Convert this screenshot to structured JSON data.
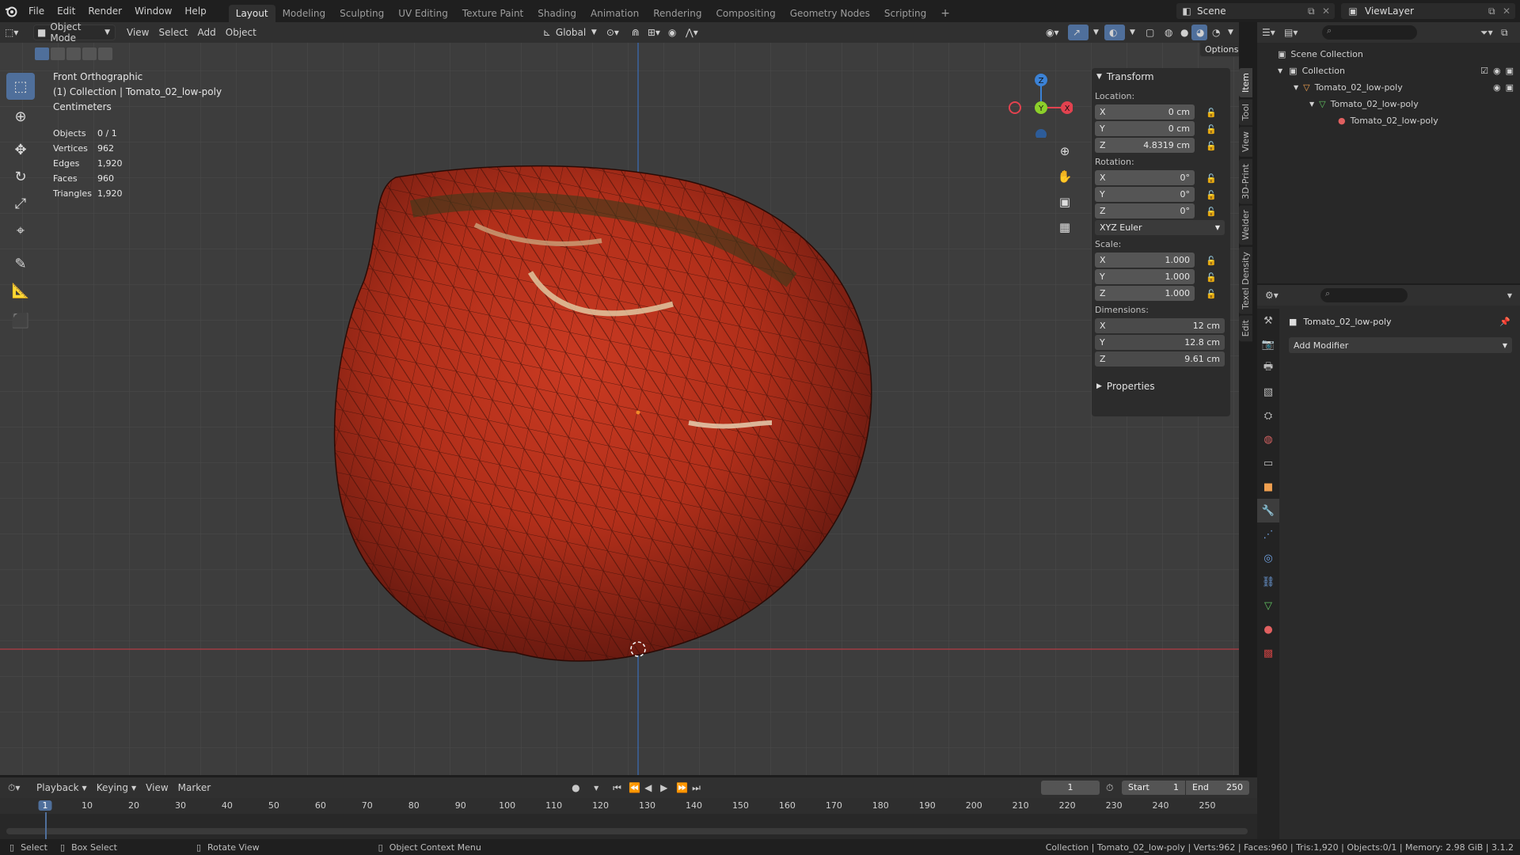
{
  "menu": {
    "items": [
      "File",
      "Edit",
      "Render",
      "Window",
      "Help"
    ],
    "workspaces": [
      "Layout",
      "Modeling",
      "Sculpting",
      "UV Editing",
      "Texture Paint",
      "Shading",
      "Animation",
      "Rendering",
      "Compositing",
      "Geometry Nodes",
      "Scripting"
    ],
    "active_workspace": "Layout",
    "add_tab": "+",
    "scene_label": "Scene",
    "viewlayer_label": "ViewLayer"
  },
  "vp_header": {
    "mode": "Object Mode",
    "menus": [
      "View",
      "Select",
      "Add",
      "Object"
    ],
    "orientation": "Global",
    "options": "Options"
  },
  "overlay": {
    "view_name": "Front Orthographic",
    "collection": "(1) Collection | Tomato_02_low-poly",
    "units": "Centimeters",
    "stats": [
      {
        "label": "Objects",
        "value": "0 / 1"
      },
      {
        "label": "Vertices",
        "value": "962"
      },
      {
        "label": "Edges",
        "value": "1,920"
      },
      {
        "label": "Faces",
        "value": "960"
      },
      {
        "label": "Triangles",
        "value": "1,920"
      }
    ]
  },
  "gizmo": {
    "z": "Z",
    "y": "Y",
    "x": "X"
  },
  "npanel": {
    "title": "Transform",
    "location_label": "Location:",
    "location": [
      {
        "axis": "X",
        "value": "0 cm"
      },
      {
        "axis": "Y",
        "value": "0 cm"
      },
      {
        "axis": "Z",
        "value": "4.8319 cm"
      }
    ],
    "rotation_label": "Rotation:",
    "rotation": [
      {
        "axis": "X",
        "value": "0°"
      },
      {
        "axis": "Y",
        "value": "0°"
      },
      {
        "axis": "Z",
        "value": "0°"
      }
    ],
    "rotation_mode": "XYZ Euler",
    "scale_label": "Scale:",
    "scale": [
      {
        "axis": "X",
        "value": "1.000"
      },
      {
        "axis": "Y",
        "value": "1.000"
      },
      {
        "axis": "Z",
        "value": "1.000"
      }
    ],
    "dimensions_label": "Dimensions:",
    "dimensions": [
      {
        "axis": "X",
        "value": "12 cm"
      },
      {
        "axis": "Y",
        "value": "12.8 cm"
      },
      {
        "axis": "Z",
        "value": "9.61 cm"
      }
    ],
    "properties_label": "Properties",
    "tabs": [
      "Item",
      "Tool",
      "View",
      "3D-Print",
      "Welder",
      "Texel Density",
      "Edit"
    ]
  },
  "outliner": {
    "scene_collection": "Scene Collection",
    "collection": "Collection",
    "object": "Tomato_02_low-poly",
    "mesh": "Tomato_02_low-poly",
    "material": "Tomato_02_low-poly"
  },
  "properties": {
    "object_name": "Tomato_02_low-poly",
    "add_modifier": "Add Modifier"
  },
  "timeline": {
    "menus": [
      "Playback",
      "Keying",
      "View",
      "Marker"
    ],
    "current_frame": "1",
    "start_label": "Start",
    "start": "1",
    "end_label": "End",
    "end": "250",
    "ticks": [
      "1",
      "10",
      "20",
      "30",
      "40",
      "50",
      "60",
      "70",
      "80",
      "90",
      "100",
      "110",
      "120",
      "130",
      "140",
      "150",
      "160",
      "170",
      "180",
      "190",
      "200",
      "210",
      "220",
      "230",
      "240",
      "250"
    ]
  },
  "status": {
    "select": "Select",
    "box_select": "Box Select",
    "rotate_view": "Rotate View",
    "context_menu": "Object Context Menu",
    "info": "Collection | Tomato_02_low-poly | Verts:962 | Faces:960 | Tris:1,920 | Objects:0/1 | Memory: 2.98 GiB | 3.1.2"
  },
  "colors": {
    "accent": "#4f6f9b",
    "tomato": "#b8321f",
    "x_axis": "#e2424f",
    "y_axis": "#8ccf2a",
    "z_axis": "#3b82d6"
  }
}
